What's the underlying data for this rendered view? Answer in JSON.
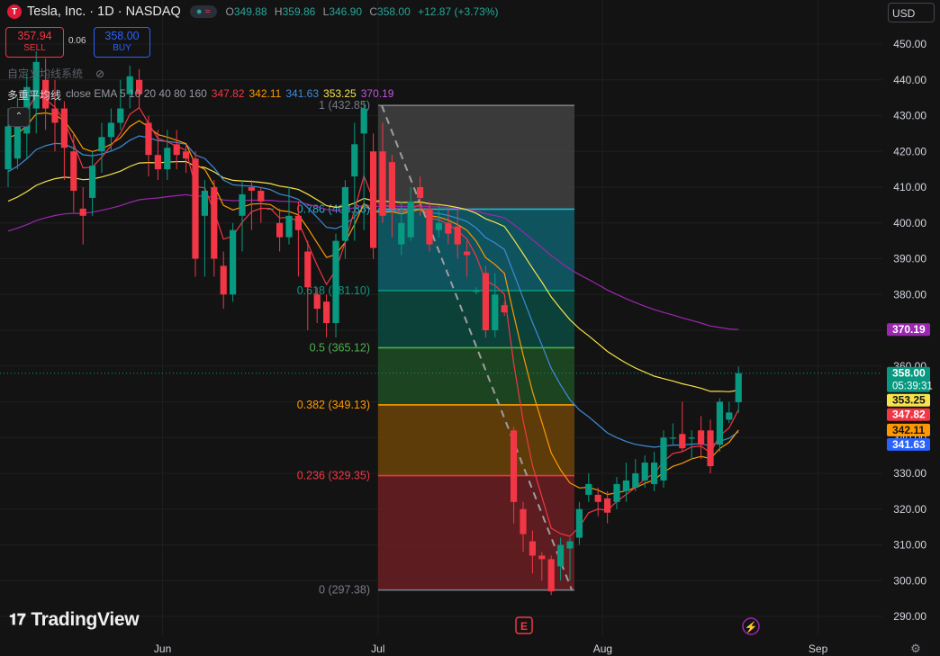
{
  "header": {
    "logo_text": "T",
    "title": "Tesla, Inc. · 1D · NASDAQ",
    "pill_dot": "●",
    "pill_sign": "≈",
    "ohlc": {
      "o_label": "O",
      "o": "349.88",
      "h_label": "H",
      "h": "359.86",
      "l_label": "L",
      "l": "346.90",
      "c_label": "C",
      "c": "358.00",
      "change": "+12.87 (+3.73%)"
    }
  },
  "trade": {
    "sell_price": "357.94",
    "sell_label": "SELL",
    "spread": "0.06",
    "buy_price": "358.00",
    "buy_label": "BUY"
  },
  "indicators": {
    "line1": "自定义均线系统",
    "line1_icon": "eye-off-icon",
    "line2_name": "多重平均线",
    "line2_params": "close EMA 5 10 20 40 80 160",
    "line2_values": [
      "347.82",
      "342.11",
      "341.63",
      "353.25",
      "370.19"
    ],
    "line2_colors": [
      "#f23645",
      "#ff9800",
      "#3d8bd9",
      "#f7e34a",
      "#9c27b0"
    ],
    "collapse_icon": "⌃"
  },
  "currency": "USD",
  "brand": "TradingView",
  "chart_data": {
    "type": "candlestick",
    "symbol": "TSLA",
    "interval": "1D",
    "y_axis_ticks": [
      290,
      300,
      310,
      320,
      330,
      340,
      350,
      360,
      370,
      380,
      390,
      400,
      410,
      420,
      430,
      440,
      450
    ],
    "x_axis_labels": [
      "Jun",
      "Jul",
      "Aug",
      "Sep"
    ],
    "ylim": [
      284,
      456
    ],
    "candles": [
      {
        "o": 415,
        "c": 427,
        "h": 432,
        "l": 410
      },
      {
        "o": 418,
        "c": 430,
        "h": 435,
        "l": 415
      },
      {
        "o": 425,
        "c": 438,
        "h": 442,
        "l": 418
      },
      {
        "o": 432,
        "c": 445,
        "h": 448,
        "l": 425
      },
      {
        "o": 440,
        "c": 432,
        "h": 446,
        "l": 426
      },
      {
        "o": 432,
        "c": 428,
        "h": 440,
        "l": 420
      },
      {
        "o": 432,
        "c": 421,
        "h": 434,
        "l": 412
      },
      {
        "o": 420,
        "c": 409,
        "h": 425,
        "l": 403
      },
      {
        "o": 404,
        "c": 402,
        "h": 410,
        "l": 394
      },
      {
        "o": 407,
        "c": 416,
        "h": 420,
        "l": 402
      },
      {
        "o": 420,
        "c": 424,
        "h": 428,
        "l": 414
      },
      {
        "o": 424,
        "c": 428,
        "h": 432,
        "l": 420
      },
      {
        "o": 428,
        "c": 432,
        "h": 440,
        "l": 426
      },
      {
        "o": 436,
        "c": 441,
        "h": 444,
        "l": 432
      },
      {
        "o": 440,
        "c": 436,
        "h": 443,
        "l": 432
      },
      {
        "o": 428,
        "c": 419,
        "h": 430,
        "l": 413
      },
      {
        "o": 419,
        "c": 415,
        "h": 426,
        "l": 412
      },
      {
        "o": 415,
        "c": 421,
        "h": 426,
        "l": 412
      },
      {
        "o": 422,
        "c": 419,
        "h": 426,
        "l": 415
      },
      {
        "o": 420,
        "c": 418,
        "h": 422,
        "l": 414
      },
      {
        "o": 418,
        "c": 390,
        "h": 420,
        "l": 385
      },
      {
        "o": 402,
        "c": 409,
        "h": 412,
        "l": 385
      },
      {
        "o": 410,
        "c": 390,
        "h": 412,
        "l": 385
      },
      {
        "o": 388,
        "c": 380,
        "h": 392,
        "l": 376
      },
      {
        "o": 380,
        "c": 398,
        "h": 400,
        "l": 378
      },
      {
        "o": 402,
        "c": 408,
        "h": 412,
        "l": 392
      },
      {
        "o": 410,
        "c": 409,
        "h": 412,
        "l": 398
      },
      {
        "o": 409,
        "c": 406,
        "h": 410,
        "l": 400
      },
      {
        "o": 404,
        "c": 404,
        "h": 404,
        "l": 404
      },
      {
        "o": 400,
        "c": 396,
        "h": 404,
        "l": 392
      },
      {
        "o": 396,
        "c": 402,
        "h": 410,
        "l": 394
      },
      {
        "o": 402,
        "c": 398,
        "h": 406,
        "l": 385
      },
      {
        "o": 392,
        "c": 382,
        "h": 395,
        "l": 370
      },
      {
        "o": 380,
        "c": 376,
        "h": 382,
        "l": 372
      },
      {
        "o": 378,
        "c": 372,
        "h": 380,
        "l": 368
      },
      {
        "o": 372,
        "c": 395,
        "h": 397,
        "l": 368
      },
      {
        "o": 395,
        "c": 410,
        "h": 412,
        "l": 390
      },
      {
        "o": 413,
        "c": 422,
        "h": 428,
        "l": 395
      },
      {
        "o": 425,
        "c": 432,
        "h": 434,
        "l": 398
      },
      {
        "o": 420,
        "c": 393,
        "h": 425,
        "l": 390
      },
      {
        "o": 420,
        "c": 402,
        "h": 428,
        "l": 400
      },
      {
        "o": 417,
        "c": 404,
        "h": 419,
        "l": 396
      },
      {
        "o": 394,
        "c": 400,
        "h": 406,
        "l": 391
      },
      {
        "o": 396,
        "c": 406,
        "h": 410,
        "l": 395
      },
      {
        "o": 410,
        "c": 407,
        "h": 413,
        "l": 402
      },
      {
        "o": 404,
        "c": 394,
        "h": 406,
        "l": 392
      },
      {
        "o": 398,
        "c": 400,
        "h": 405,
        "l": 396
      },
      {
        "o": 400,
        "c": 397,
        "h": 404,
        "l": 394
      },
      {
        "o": 399,
        "c": 394,
        "h": 404,
        "l": 390
      },
      {
        "o": 392,
        "c": 391,
        "h": 395,
        "l": 385
      },
      {
        "o": 381,
        "c": 381,
        "h": 382,
        "l": 380
      },
      {
        "o": 386,
        "c": 370,
        "h": 388,
        "l": 368
      },
      {
        "o": 370,
        "c": 380,
        "h": 386,
        "l": 368
      },
      {
        "o": 377,
        "c": 375,
        "h": 378,
        "l": 374
      },
      {
        "o": 342,
        "c": 322,
        "h": 343,
        "l": 316
      },
      {
        "o": 320,
        "c": 313,
        "h": 322,
        "l": 308
      },
      {
        "o": 311,
        "c": 307,
        "h": 314,
        "l": 302
      },
      {
        "o": 307,
        "c": 306,
        "h": 308,
        "l": 300
      },
      {
        "o": 306,
        "c": 297,
        "h": 307,
        "l": 296
      },
      {
        "o": 304,
        "c": 310,
        "h": 312,
        "l": 300
      },
      {
        "o": 309,
        "c": 311,
        "h": 312,
        "l": 300
      },
      {
        "o": 312,
        "c": 320,
        "h": 322,
        "l": 310
      },
      {
        "o": 324,
        "c": 327,
        "h": 330,
        "l": 322
      },
      {
        "o": 324,
        "c": 322,
        "h": 326,
        "l": 318
      },
      {
        "o": 323,
        "c": 319,
        "h": 325,
        "l": 316
      },
      {
        "o": 322,
        "c": 327,
        "h": 329,
        "l": 320
      },
      {
        "o": 325,
        "c": 328,
        "h": 333,
        "l": 322
      },
      {
        "o": 326,
        "c": 330,
        "h": 334,
        "l": 325
      },
      {
        "o": 328,
        "c": 333,
        "h": 335,
        "l": 326
      },
      {
        "o": 327,
        "c": 333,
        "h": 336,
        "l": 325
      },
      {
        "o": 328,
        "c": 340,
        "h": 342,
        "l": 326
      },
      {
        "o": 340,
        "c": 340,
        "h": 344,
        "l": 338
      },
      {
        "o": 341,
        "c": 337,
        "h": 350,
        "l": 336
      },
      {
        "o": 340,
        "c": 340,
        "h": 342,
        "l": 334
      },
      {
        "o": 342,
        "c": 338,
        "h": 346,
        "l": 334
      },
      {
        "o": 342,
        "c": 332,
        "h": 345,
        "l": 330
      },
      {
        "o": 338,
        "c": 350,
        "h": 351,
        "l": 336
      },
      {
        "o": 345,
        "c": 347,
        "h": 350,
        "l": 344
      },
      {
        "o": 349.88,
        "c": 358,
        "h": 359.86,
        "l": 346.9
      }
    ],
    "ema_last_values": {
      "EMA5": 347.82,
      "EMA10": 342.11,
      "EMA20": 341.63,
      "EMA40": 353.25,
      "EMA80": 370.19
    },
    "fibonacci": {
      "levels": [
        {
          "ratio": "1",
          "price": 432.85,
          "label": "1 (432.85)",
          "line": "#787b86",
          "fill": "#424242"
        },
        {
          "ratio": "0.786",
          "price": 403.86,
          "label": "0.786 (403.86)",
          "line": "#1fb5d1",
          "fill": "#0e5f6b"
        },
        {
          "ratio": "0.618",
          "price": 381.1,
          "label": "0.618 (381.10)",
          "line": "#089981",
          "fill": "#0b4a3f"
        },
        {
          "ratio": "0.5",
          "price": 365.12,
          "label": "0.5 (365.12)",
          "line": "#4caf50",
          "fill": "#1f4e24"
        },
        {
          "ratio": "0.382",
          "price": 349.13,
          "label": "0.382 (349.13)",
          "line": "#ff9800",
          "fill": "#6b4408"
        },
        {
          "ratio": "0.236",
          "price": 329.35,
          "label": "0.236 (329.35)",
          "line": "#f23645",
          "fill": "#6b1e22"
        },
        {
          "ratio": "0",
          "price": 297.38,
          "label": "0 (297.38)",
          "line": "#787b86",
          "fill": null
        }
      ]
    },
    "price_badges": [
      {
        "text": "370.19",
        "value": 370.19,
        "bg": "#9c27b0",
        "fg": "#ffffff"
      },
      {
        "text": "358.00",
        "sub": "05:39:31",
        "value": 358.0,
        "bg": "#089981",
        "fg": "#ffffff"
      },
      {
        "text": "353.25",
        "value": 353.25,
        "bg": "#f7e34a",
        "fg": "#131313"
      },
      {
        "text": "347.82",
        "value": 347.82,
        "bg": "#f23645",
        "fg": "#ffffff"
      },
      {
        "text": "342.11",
        "value": 342.11,
        "bg": "#ff9800",
        "fg": "#131313"
      },
      {
        "text": "341.63",
        "value": 341.63,
        "bg": "#2962ff",
        "fg": "#ffffff"
      }
    ],
    "event_markers": [
      {
        "text": "E",
        "color": "#f23645"
      },
      {
        "text": "⚡",
        "color": "#9c27b0"
      }
    ],
    "axis_icon": "⚙",
    "colors": {
      "up": "#089981",
      "down": "#f23645",
      "grid": "#1f1f1f",
      "bg": "#131313",
      "axis_text": "#d1d4dc"
    }
  }
}
